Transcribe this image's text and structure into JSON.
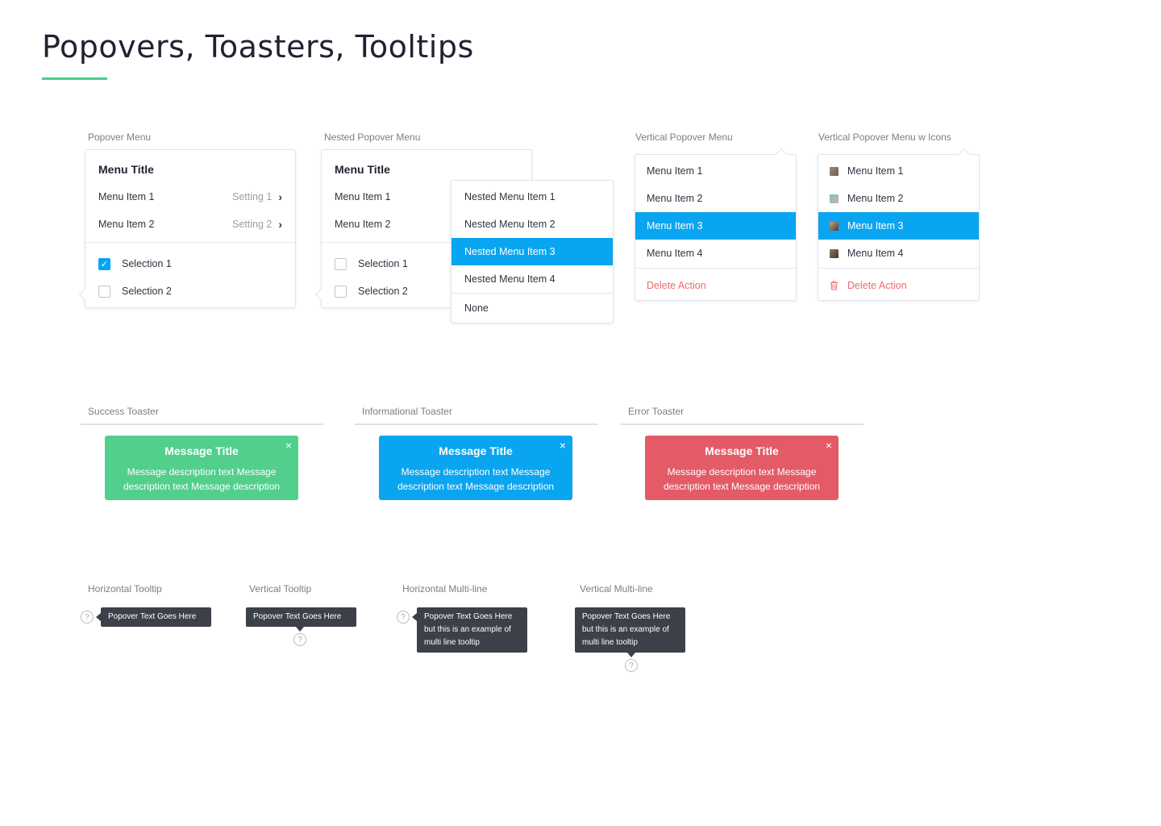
{
  "page": {
    "title": "Popovers, Toasters, Tooltips",
    "accent": "#4fcb8c"
  },
  "popover_menu": {
    "label": "Popover Menu",
    "title": "Menu Title",
    "items": [
      {
        "label": "Menu Item 1",
        "setting": "Setting 1"
      },
      {
        "label": "Menu Item 2",
        "setting": "Setting 2"
      }
    ],
    "selections": [
      {
        "label": "Selection 1",
        "checked": true
      },
      {
        "label": "Selection 2",
        "checked": false
      }
    ]
  },
  "nested_popover_menu": {
    "label": "Nested Popover Menu",
    "title": "Menu Title",
    "items": [
      "Menu Item 1",
      "Menu Item 2"
    ],
    "selections": [
      {
        "label": "Selection 1",
        "checked": false
      },
      {
        "label": "Selection 2",
        "checked": false
      }
    ],
    "nested_items": [
      "Nested Menu Item 1",
      "Nested Menu Item 2",
      "Nested Menu Item 3",
      "Nested Menu Item 4"
    ],
    "nested_selected": "Nested Menu Item 3",
    "nested_footer": "None"
  },
  "vertical_popover_menu": {
    "label": "Vertical Popover Menu",
    "items": [
      "Menu Item 1",
      "Menu Item 2",
      "Menu Item 3",
      "Menu Item 4"
    ],
    "selected": "Menu Item 3",
    "delete_action": "Delete Action"
  },
  "vertical_popover_menu_icons": {
    "label": "Vertical Popover Menu w Icons",
    "items": [
      "Menu Item 1",
      "Menu Item 2",
      "Menu Item 3",
      "Menu Item 4"
    ],
    "icons": [
      "image-thumbnail-icon",
      "image-thumbnail-icon",
      "image-thumbnail-icon",
      "image-thumbnail-icon"
    ],
    "selected": "Menu Item 3",
    "delete_action": "Delete Action",
    "delete_icon": "trash-icon"
  },
  "toasters": {
    "success": {
      "label": "Success Toaster",
      "title": "Message Title",
      "description": "Message description text Message description text Message description",
      "color": "#52ce8d"
    },
    "informational": {
      "label": "Informational Toaster",
      "title": "Message Title",
      "description": "Message description text Message description text Message description",
      "color": "#0aa5f0"
    },
    "error": {
      "label": "Error Toaster",
      "title": "Message Title",
      "description": "Message description text Message description text Message description",
      "color": "#e45a67"
    },
    "close_glyph": "×"
  },
  "tooltips": {
    "horizontal": {
      "label": "Horizontal Tooltip",
      "text": "Popover Text Goes Here"
    },
    "vertical": {
      "label": "Vertical Tooltip",
      "text": "Popover Text Goes Here"
    },
    "horizontal_multiline": {
      "label": "Horizontal Multi-line",
      "lines": [
        "Popover Text Goes Here",
        "but this is an example of",
        "multi line tooltip"
      ]
    },
    "vertical_multiline": {
      "label": "Vertical Multi-line",
      "lines": [
        "Popover Text Goes Here",
        "but this is an example of",
        "multi line tooltip"
      ]
    },
    "help_glyph": "?",
    "bg_color": "#3c4049"
  },
  "colors": {
    "selected": "#0aa5f0",
    "danger": "#ef6a6e"
  }
}
